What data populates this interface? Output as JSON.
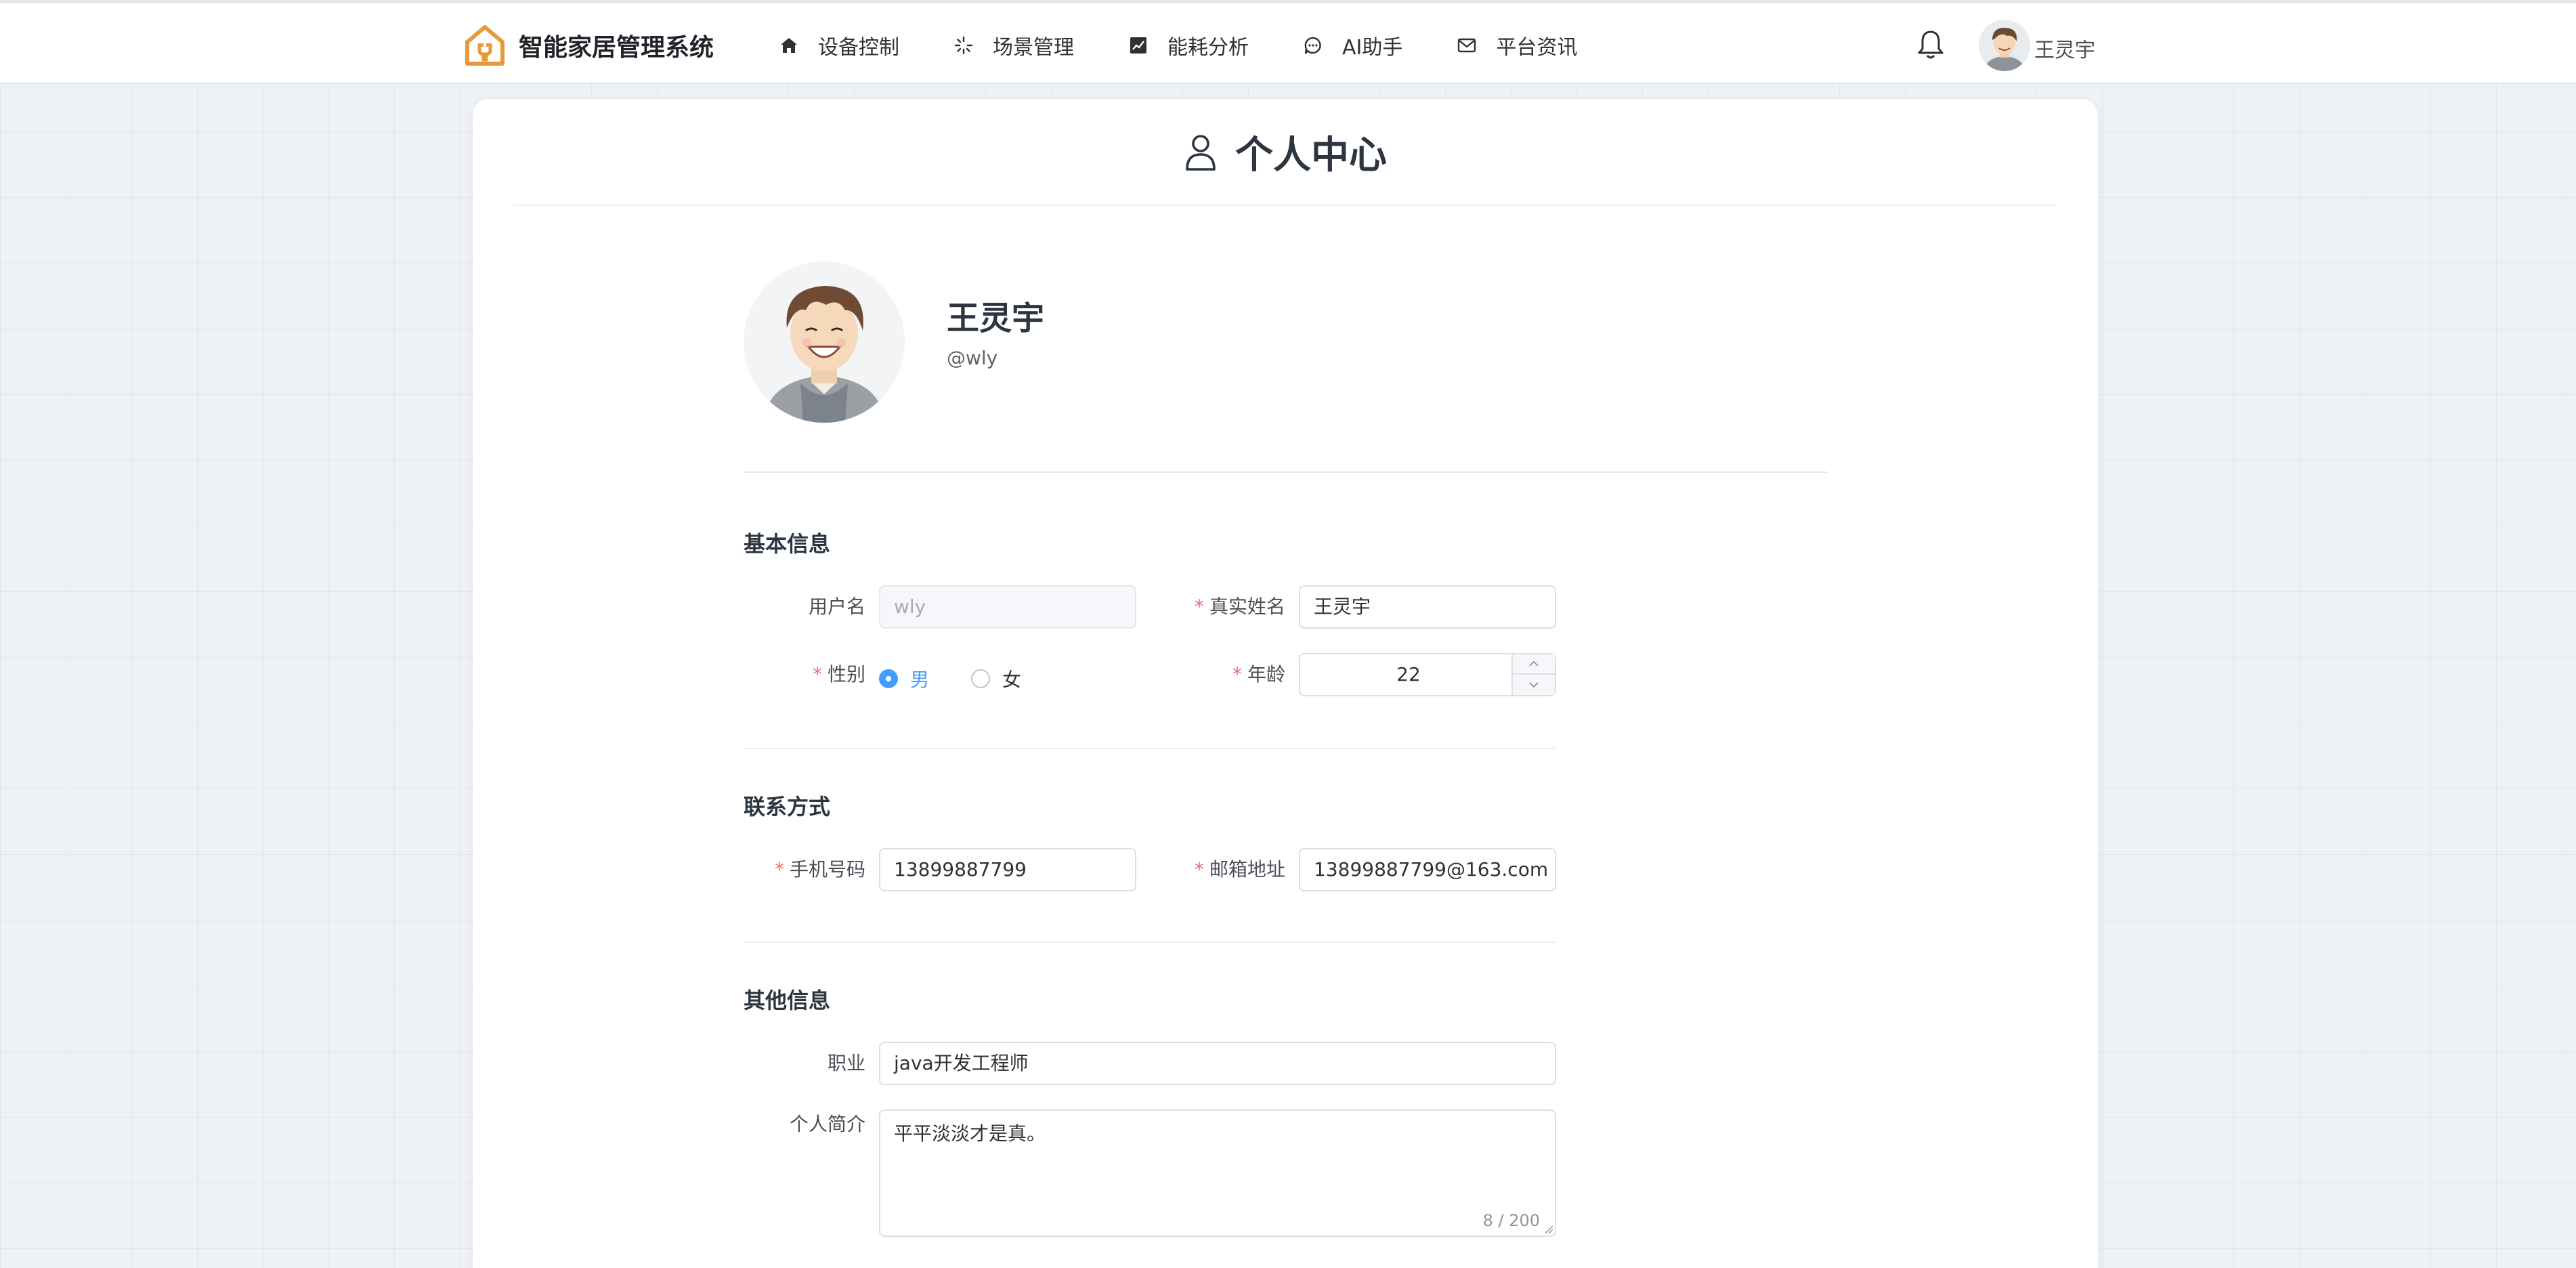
{
  "app": {
    "title": "智能家居管理系统",
    "brand_color": "#e69a3a"
  },
  "nav": {
    "items": [
      {
        "label": "设备控制",
        "icon": "home-icon"
      },
      {
        "label": "场景管理",
        "icon": "loading-spark-icon"
      },
      {
        "label": "能耗分析",
        "icon": "chart-icon"
      },
      {
        "label": "AI助手",
        "icon": "chat-bubble-icon"
      },
      {
        "label": "平台资讯",
        "icon": "mail-icon"
      }
    ]
  },
  "header": {
    "username": "王灵宇",
    "bell_icon": "bell-icon"
  },
  "page": {
    "title": "个人中心",
    "icon": "user-icon"
  },
  "profile": {
    "name": "王灵宇",
    "handle": "@wly"
  },
  "basic": {
    "title": "基本信息",
    "username_label": "用户名",
    "username_value": "wly",
    "realname_label": "真实姓名",
    "realname_value": "王灵宇",
    "gender_label": "性别",
    "gender_male": "男",
    "gender_female": "女",
    "gender_selected": "男",
    "age_label": "年龄",
    "age_value": "22"
  },
  "contact": {
    "title": "联系方式",
    "phone_label": "手机号码",
    "phone_value": "13899887799",
    "email_label": "邮箱地址",
    "email_value": "13899887799@163.com"
  },
  "other": {
    "title": "其他信息",
    "job_label": "职业",
    "job_value": "java开发工程师",
    "bio_label": "个人简介",
    "bio_value": "平平淡淡才是真。",
    "bio_counter": "8 / 200"
  },
  "colors": {
    "accent": "#409eff",
    "required": "#f56c6c",
    "background": "#eef1f6"
  }
}
